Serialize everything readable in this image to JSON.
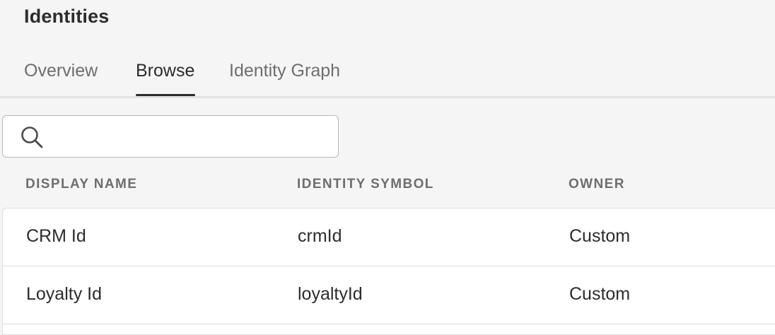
{
  "page": {
    "title": "Identities"
  },
  "tabs": [
    {
      "label": "Overview",
      "selected": false
    },
    {
      "label": "Browse",
      "selected": true
    },
    {
      "label": "Identity Graph",
      "selected": false
    }
  ],
  "search": {
    "value": "",
    "placeholder": ""
  },
  "table": {
    "columns": [
      "DISPLAY NAME",
      "IDENTITY SYMBOL",
      "OWNER"
    ],
    "rows": [
      {
        "display_name": "CRM Id",
        "identity_symbol": "crmId",
        "owner": "Custom"
      },
      {
        "display_name": "Loyalty Id",
        "identity_symbol": "loyaltyId",
        "owner": "Custom"
      }
    ]
  },
  "icons": {
    "search": "search-icon"
  }
}
